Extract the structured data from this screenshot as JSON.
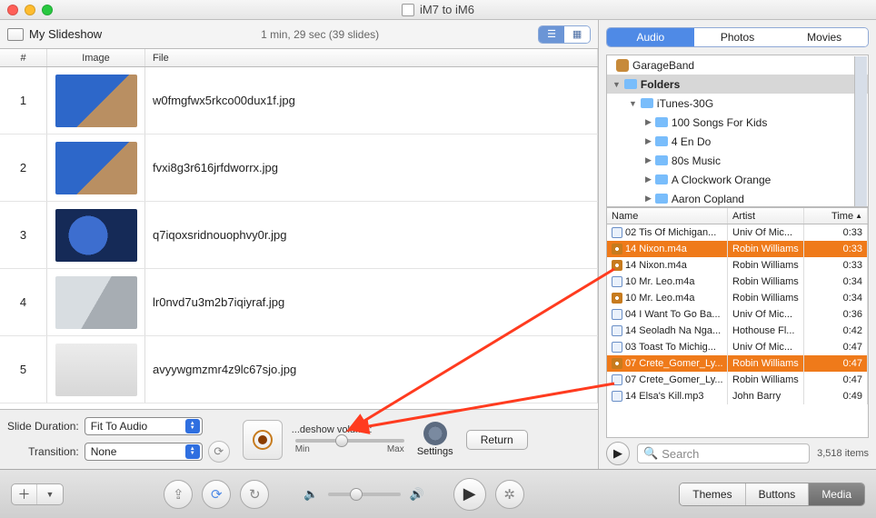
{
  "window": {
    "title": "iM7 to iM6"
  },
  "slideshow": {
    "name": "My Slideshow",
    "info": "1 min, 29 sec  (39 slides)",
    "columns": {
      "num": "#",
      "image": "Image",
      "file": "File"
    },
    "rows": [
      {
        "n": "1",
        "file": "w0fmgfwx5rkco00dux1f.jpg",
        "thumb": "t1"
      },
      {
        "n": "2",
        "file": "fvxi8g3r616jrfdworrx.jpg",
        "thumb": "t1"
      },
      {
        "n": "3",
        "file": "q7iqoxsridnouophvy0r.jpg",
        "thumb": "t3"
      },
      {
        "n": "4",
        "file": "lr0nvd7u3m2b7iqiyraf.jpg",
        "thumb": "t4"
      },
      {
        "n": "5",
        "file": "avyywgmzmr4z9lc67sjo.jpg",
        "thumb": "t5"
      }
    ]
  },
  "controls": {
    "duration_label": "Slide Duration:",
    "duration_value": "Fit To Audio",
    "transition_label": "Transition:",
    "transition_value": "None",
    "volume_label": "...deshow volume:",
    "min": "Min",
    "max": "Max",
    "settings": "Settings",
    "return": "Return"
  },
  "media": {
    "tabs": {
      "audio": "Audio",
      "photos": "Photos",
      "movies": "Movies"
    },
    "tree": [
      {
        "indent": 0,
        "icon": "gb",
        "label": "GarageBand",
        "arrow": ""
      },
      {
        "indent": 0,
        "icon": "folder",
        "label": "Folders",
        "arrow": "▼",
        "sel": true
      },
      {
        "indent": 1,
        "icon": "folder",
        "label": "iTunes-30G",
        "arrow": "▼"
      },
      {
        "indent": 2,
        "icon": "folder",
        "label": "100 Songs For Kids",
        "arrow": "▶"
      },
      {
        "indent": 2,
        "icon": "folder",
        "label": "4 En Do",
        "arrow": "▶"
      },
      {
        "indent": 2,
        "icon": "folder",
        "label": "80s Music",
        "arrow": "▶"
      },
      {
        "indent": 2,
        "icon": "folder",
        "label": "A Clockwork Orange",
        "arrow": "▶"
      },
      {
        "indent": 2,
        "icon": "folder",
        "label": "Aaron Copland",
        "arrow": "▶"
      }
    ],
    "cols": {
      "name": "Name",
      "artist": "Artist",
      "time": "Time"
    },
    "songs": [
      {
        "icn": "b",
        "name": "02 Tis Of Michigan...",
        "artist": "Univ Of Mic...",
        "time": "0:33",
        "sel": false
      },
      {
        "icn": "o",
        "name": "14 Nixon.m4a",
        "artist": "Robin Williams",
        "time": "0:33",
        "sel": true
      },
      {
        "icn": "o",
        "name": "14 Nixon.m4a",
        "artist": "Robin Williams",
        "time": "0:33",
        "sel": false
      },
      {
        "icn": "b",
        "name": "10 Mr. Leo.m4a",
        "artist": "Robin Williams",
        "time": "0:34",
        "sel": false
      },
      {
        "icn": "o",
        "name": "10 Mr. Leo.m4a",
        "artist": "Robin Williams",
        "time": "0:34",
        "sel": false
      },
      {
        "icn": "b",
        "name": "04 I Want To Go Ba...",
        "artist": "Univ Of Mic...",
        "time": "0:36",
        "sel": false
      },
      {
        "icn": "b",
        "name": "14 Seoladh Na Nga...",
        "artist": "Hothouse Fl...",
        "time": "0:42",
        "sel": false
      },
      {
        "icn": "b",
        "name": "03 Toast To Michig...",
        "artist": "Univ Of Mic...",
        "time": "0:47",
        "sel": false
      },
      {
        "icn": "o",
        "name": "07 Crete_Gomer_Ly...",
        "artist": "Robin Williams",
        "time": "0:47",
        "sel": true
      },
      {
        "icn": "b",
        "name": "07 Crete_Gomer_Ly...",
        "artist": "Robin Williams",
        "time": "0:47",
        "sel": false
      },
      {
        "icn": "b",
        "name": "14 Elsa's Kill.mp3",
        "artist": "John Barry",
        "time": "0:49",
        "sel": false
      }
    ],
    "search_placeholder": "Search",
    "count": "3,518 items"
  },
  "bottom": {
    "themes": "Themes",
    "buttons": "Buttons",
    "media": "Media"
  }
}
